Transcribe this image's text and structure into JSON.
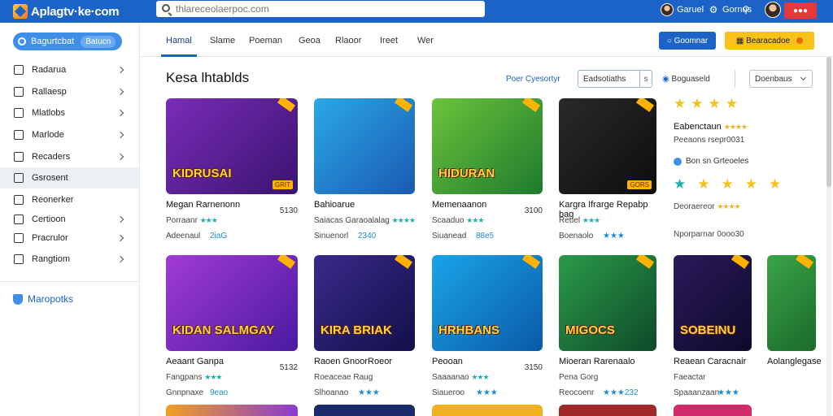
{
  "app": {
    "brand": "Aplagtv·ke·com"
  },
  "search": {
    "placeholder": "thlareceolaerpoc.com",
    "value": ""
  },
  "topbar": {
    "user1_label": "Garuel",
    "user2_label": "Gornus"
  },
  "sidebar": {
    "pill_label": "Bagurtcbat",
    "pill_badge": "Batucn",
    "items": [
      {
        "label": "Radarua",
        "chevron": true,
        "active": false
      },
      {
        "label": "Rallaesp",
        "chevron": true,
        "active": false
      },
      {
        "label": "Mlatlobs",
        "chevron": true,
        "active": false
      },
      {
        "label": "Marlode",
        "chevron": true,
        "active": false
      },
      {
        "label": "Recaders",
        "chevron": true,
        "active": false
      },
      {
        "label": "Gsrosent",
        "chevron": false,
        "active": true
      },
      {
        "label": "Reonerker",
        "chevron": false,
        "active": false
      },
      {
        "label": "Certioon",
        "chevron": true,
        "active": false
      },
      {
        "label": "Pracrulor",
        "chevron": true,
        "active": false
      },
      {
        "label": "Rangtiom",
        "chevron": true,
        "active": false
      }
    ],
    "footer_label": "Maropotks"
  },
  "nav": {
    "tabs": [
      "Hamal",
      "Slame",
      "Poeman",
      "Geoa",
      "Rlaoor",
      "Ireet",
      "Wer"
    ],
    "active_tab": 0,
    "blue_button": "Goomnar",
    "yellow_button": "Bearacadoe"
  },
  "content": {
    "section_title": "Kesa lhtablds",
    "filter_link": "Poer Cyesortyr",
    "filter_box": "Eadsotiaths",
    "filter_box_x": "s",
    "filter_select": "Boguaseld",
    "sort_select": "Doenbaus"
  },
  "cards": [
    {
      "thumb_title": "KIDRUSAI",
      "thumb_tag": "GRIT",
      "name": "Megan Rarnenonn",
      "num": "5130",
      "dev": "Porraanr",
      "dev_rating": "★★★",
      "meta": "Adeenaul",
      "tag": "2iaG",
      "colors": [
        "#7a2cb8",
        "#3a1470"
      ]
    },
    {
      "thumb_title": "",
      "thumb_tag": "",
      "name": "Bahioarue",
      "num": "",
      "dev": "Saiacas Garaoalalag",
      "dev_rating": "★★★★",
      "meta": "Sinuenorl",
      "tag": "2340",
      "colors": [
        "#2aa8e8",
        "#1a5ab0"
      ]
    },
    {
      "thumb_title": "HIDURAN",
      "thumb_tag": "",
      "name": "Memenaanon",
      "num": "3100",
      "dev": "Scaaduo",
      "dev_rating": "★★★",
      "meta": "Siuanead",
      "tag": "88e5",
      "colors": [
        "#6bc43a",
        "#1e7a2e"
      ]
    },
    {
      "thumb_title": "",
      "thumb_tag": "GORS",
      "name": "Kargra Ifrarge Repabp bag",
      "num": "",
      "dev": "Reuel",
      "dev_rating": "★★★",
      "meta": "Boenaolo",
      "tag": "★★★",
      "colors": [
        "#2a2a2a",
        "#0d0d0d"
      ]
    },
    {
      "thumb_title": "KIDAN SALMGAY",
      "thumb_tag": "",
      "name": "Aeaant Ganpa",
      "num": "5132",
      "dev": "Fangpans",
      "dev_rating": "★★★",
      "meta": "Gnnpnaxe",
      "tag": "9eao",
      "colors": [
        "#a13bd6",
        "#4a1aa0"
      ]
    },
    {
      "thumb_title": "KIRA BRIAK",
      "thumb_tag": "",
      "name": "Raoen GnoorRoeor",
      "num": "",
      "dev": "Roeaceae Raug",
      "dev_rating": "",
      "meta": "Slhoanao",
      "tag": "★★★",
      "colors": [
        "#3a2a8a",
        "#12104a"
      ]
    },
    {
      "thumb_title": "HRHBANS",
      "thumb_tag": "",
      "name": "Peooan",
      "num": "3150",
      "dev": "Saaaanao",
      "dev_rating": "★★★",
      "meta": "Siaueroo",
      "tag": "★★★",
      "colors": [
        "#1aa4e8",
        "#0a5aa8"
      ]
    },
    {
      "thumb_title": "MIGOCS",
      "thumb_tag": "",
      "name": "Mioeran Rarenaalo",
      "num": "",
      "dev": "Pena Gorg",
      "dev_rating": "",
      "meta": "Reocoenr",
      "tag": "★★★232",
      "colors": [
        "#2a9a48",
        "#0e4a2a"
      ]
    },
    {
      "thumb_title": "SOBEINU",
      "thumb_tag": "",
      "name": "Reaean Caracnair",
      "num": "",
      "dev": "Faeactar",
      "dev_rating": "",
      "meta": "Spaaanzaan",
      "tag": "★★★",
      "colors": [
        "#2a1a5a",
        "#0f0a2a"
      ]
    },
    {
      "thumb_title": "",
      "thumb_tag": "",
      "name": "Aolanglegase",
      "num": "",
      "dev": "",
      "dev_rating": "",
      "meta": "",
      "tag": "",
      "colors": [
        "#3aa448",
        "#1a6a2a"
      ]
    }
  ],
  "rating_panel": {
    "title": "Eabenctaun",
    "title_stars": "★★★★",
    "sub": "Peeaons  rsepr0031",
    "badge": "Bon sn Grteoeles",
    "line1": "Deoraereor",
    "line1_stars": "★★★★",
    "line2": "Nporparnar",
    "line2_num": "0ooo30",
    "stars_row": "★★★★",
    "stars_row2": "★★★★"
  }
}
